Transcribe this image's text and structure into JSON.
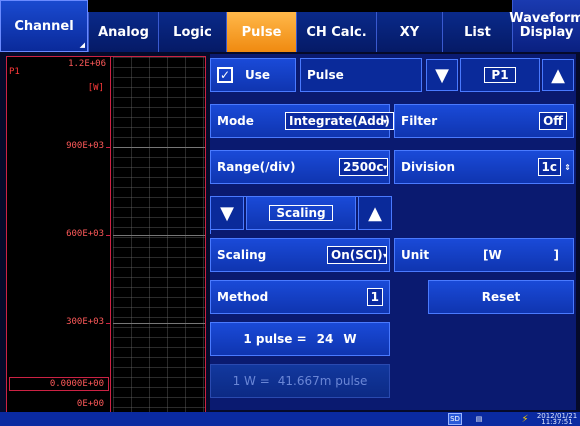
{
  "tabs": [
    {
      "label": "Channel"
    },
    {
      "label": "Analog"
    },
    {
      "label": "Logic"
    },
    {
      "label": "Pulse"
    },
    {
      "label": "CH Calc."
    },
    {
      "label": "XY"
    },
    {
      "label": "List"
    },
    {
      "label_line1": "Waveform",
      "label_line2": "Display"
    }
  ],
  "waveform": {
    "channel": "P1",
    "unit": "[W]",
    "scale_top": "1.2E+06",
    "scale_900k": "900E+03",
    "scale_600k": "600E+03",
    "scale_300k": "300E+03",
    "scale_zero": "0.0000E+00",
    "scale_bottom": "0E+00"
  },
  "settings": {
    "use_label": "Use",
    "use_checked": "✓",
    "type_value": "Pulse",
    "channel_value": "P1",
    "mode_label": "Mode",
    "mode_value": "Integrate(Add)",
    "filter_label": "Filter",
    "filter_value": "Off",
    "range_label": "Range(/div)",
    "range_value": "2500c",
    "division_label": "Division",
    "division_value": "1c",
    "scaling_header": "Scaling",
    "scaling_label": "Scaling",
    "scaling_value": "On(SCI)",
    "unit_label": "Unit",
    "unit_value_open": "[W",
    "unit_value_close": "]",
    "method_label": "Method",
    "method_value": "1",
    "reset_label": "Reset",
    "pulse_eq_label": "1 pulse =",
    "pulse_eq_value": "24",
    "pulse_eq_unit": "W",
    "w_eq_label": "1 W =",
    "w_eq_value": "41.667m pulse"
  },
  "status": {
    "sd": "SD",
    "date": "2012/01/21",
    "time": "11:37:51"
  },
  "colors": {
    "active_tab": "#f08a10",
    "waveform_red": "#ff3a3a",
    "panel_blue": "#0f35b0"
  }
}
